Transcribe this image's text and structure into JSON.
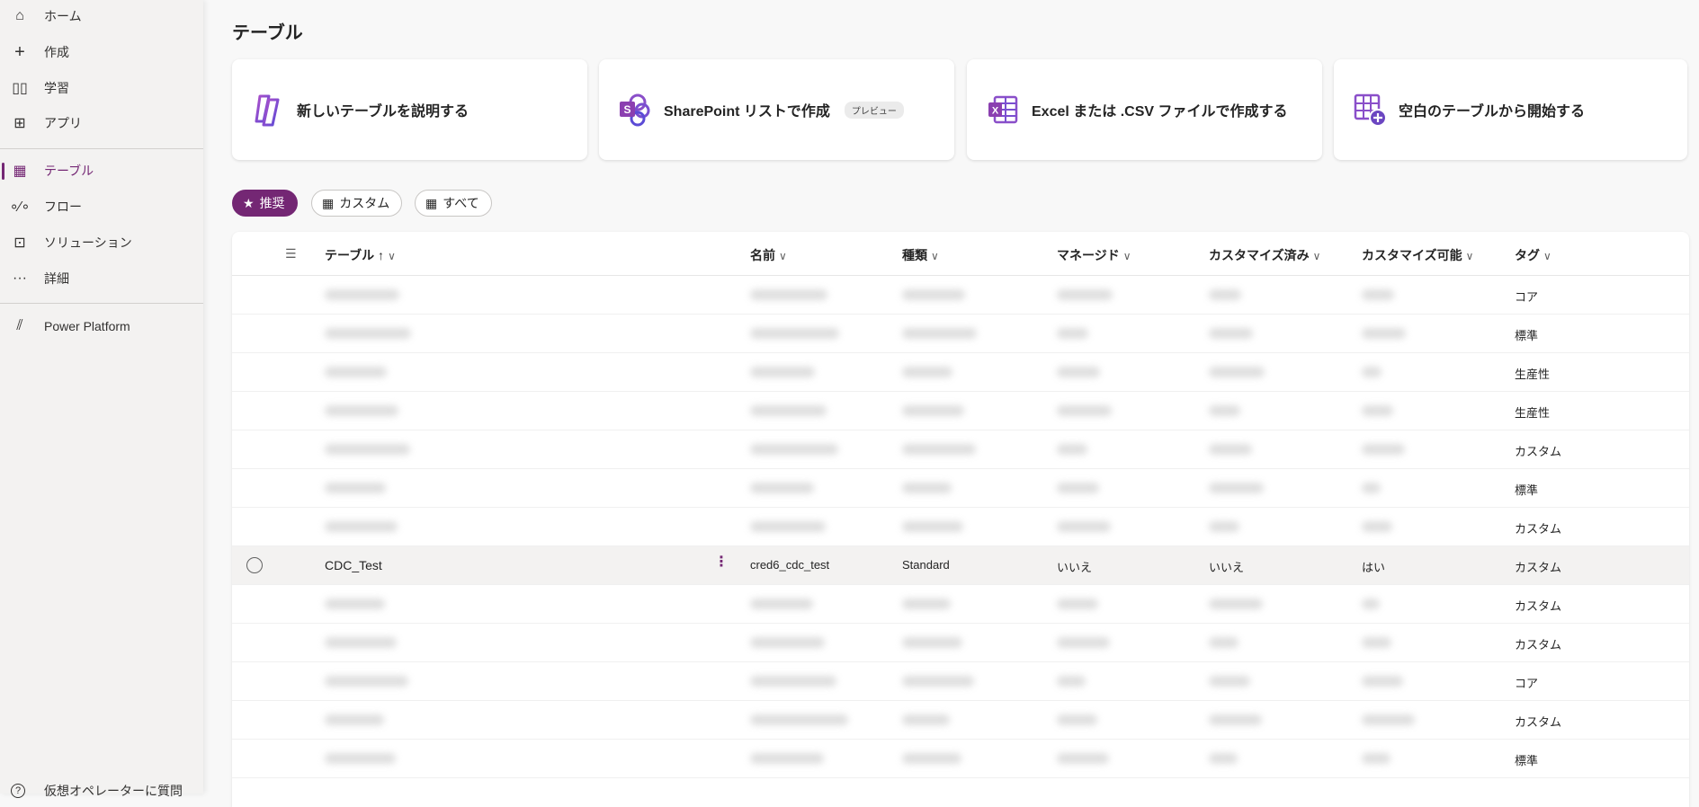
{
  "sidebar": {
    "items": [
      {
        "label": "ホーム",
        "icon": "home-icon"
      },
      {
        "label": "作成",
        "icon": "plus-icon"
      },
      {
        "label": "学習",
        "icon": "book-icon"
      },
      {
        "label": "アプリ",
        "icon": "apps-icon"
      },
      {
        "label": "テーブル",
        "icon": "table-icon",
        "active": true
      },
      {
        "label": "フロー",
        "icon": "flow-icon"
      },
      {
        "label": "ソリューション",
        "icon": "solution-icon"
      },
      {
        "label": "詳細",
        "icon": "more-icon"
      },
      {
        "label": "Power Platform",
        "icon": "power-platform-icon"
      }
    ],
    "help_label": "仮想オペレーターに質問"
  },
  "page": {
    "title": "テーブル"
  },
  "cards": [
    {
      "label": "新しいテーブルを説明する",
      "icon": "copilot-icon"
    },
    {
      "label": "SharePoint リストで作成",
      "badge": "プレビュー",
      "icon": "sharepoint-icon"
    },
    {
      "label": "Excel または .CSV ファイルで作成する",
      "icon": "excel-icon"
    },
    {
      "label": "空白のテーブルから開始する",
      "icon": "table-add-icon"
    }
  ],
  "filters": [
    {
      "label": "推奨",
      "selected": true
    },
    {
      "label": "カスタム"
    },
    {
      "label": "すべて"
    }
  ],
  "table": {
    "columns": [
      "テーブル ↑",
      "名前",
      "種類",
      "マネージド",
      "カスタマイズ済み",
      "カスタマイズ可能",
      "タグ"
    ],
    "rows": [
      {
        "tag": "コア"
      },
      {
        "tag": "標準"
      },
      {
        "tag": "生産性"
      },
      {
        "tag": "生産性"
      },
      {
        "tag": "カスタム"
      },
      {
        "tag": "標準"
      },
      {
        "tag": "カスタム"
      },
      {
        "table": "CDC_Test",
        "name": "cred6_cdc_test",
        "type": "Standard",
        "managed": "いいえ",
        "customized": "いいえ",
        "customizable": "はい",
        "tag": "カスタム",
        "visible": true
      },
      {
        "tag": "カスタム"
      },
      {
        "tag": "カスタム"
      },
      {
        "tag": "コア"
      },
      {
        "tag": "カスタム"
      },
      {
        "tag": "標準"
      }
    ]
  },
  "colors": {
    "accent": "#742774"
  }
}
